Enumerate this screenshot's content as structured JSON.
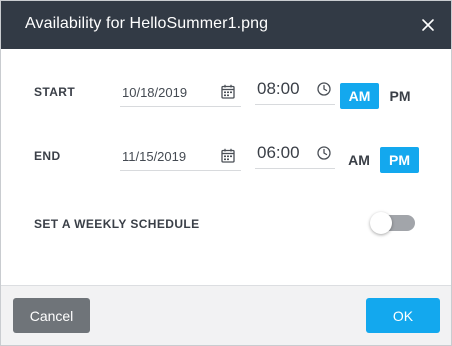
{
  "dialog": {
    "title": "Availability for HelloSummer1.png",
    "close_icon": "close-icon"
  },
  "start": {
    "label": "START",
    "date": "10/18/2019",
    "time": "08:00",
    "am_label": "AM",
    "pm_label": "PM",
    "selected": "AM"
  },
  "end": {
    "label": "END",
    "date": "11/15/2019",
    "time": "06:00",
    "am_label": "AM",
    "pm_label": "PM",
    "selected": "PM"
  },
  "weekly": {
    "label": "SET A WEEKLY SCHEDULE",
    "enabled": false
  },
  "footer": {
    "cancel_label": "Cancel",
    "ok_label": "OK"
  },
  "colors": {
    "header_bg": "#323a45",
    "accent": "#13a8ee",
    "cancel_bg": "#6f7479",
    "toggle_off": "#a2a5aa"
  }
}
